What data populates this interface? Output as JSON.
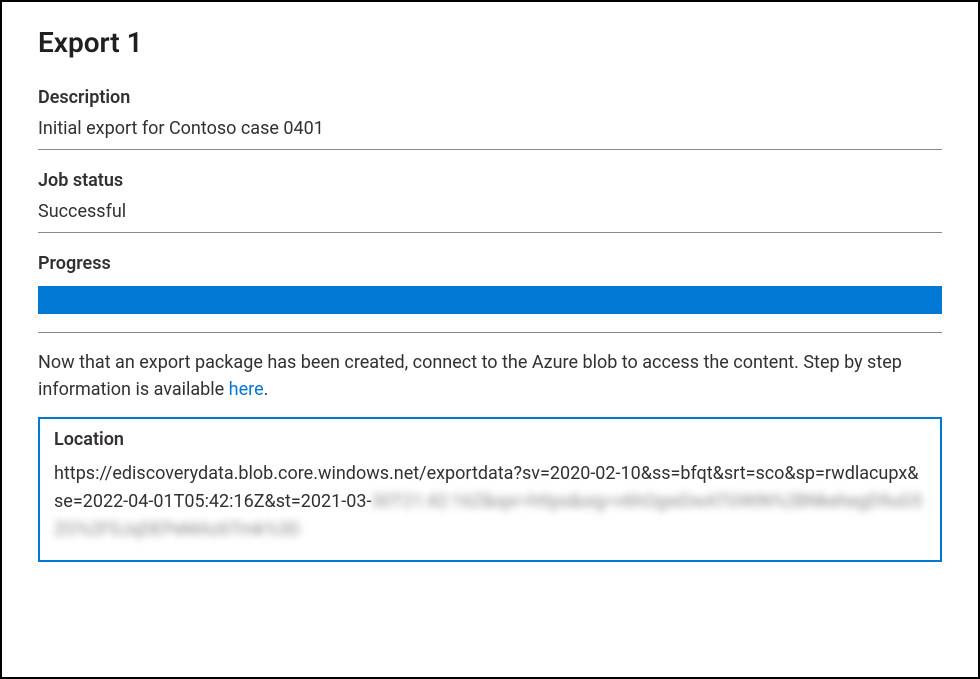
{
  "title": "Export 1",
  "description": {
    "label": "Description",
    "value": "Initial export for Contoso case 0401"
  },
  "job_status": {
    "label": "Job status",
    "value": "Successful"
  },
  "progress": {
    "label": "Progress",
    "percent": 100,
    "bar_color": "#0078d4"
  },
  "instructions": {
    "text_before": "Now that an export package has been created, connect to the Azure blob to access the content. Step by step information is available ",
    "link_text": "here",
    "text_after": "."
  },
  "location": {
    "label": "Location",
    "url_visible": "https://ediscoverydata.blob.core.windows.net/exportdata?sv=2020-02-10&ss=bfqt&srt=sco&sp=rwdlacupx&se=2022-04-01T05:42:16Z&st=2021-03-",
    "url_redacted": "30T21:42:16Z&spr=https&sig=v6hOgwDwATGWIN%2BNkehegD9uG5ZO%2F0JqDEPeMAz6Tmk%3D"
  }
}
